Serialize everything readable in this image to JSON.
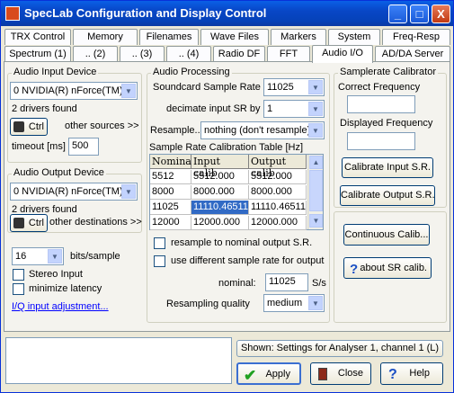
{
  "window": {
    "title": "SpecLab   Configuration and Display Control",
    "min": "_",
    "max": "□",
    "close": "X"
  },
  "tabs_row1": [
    "TRX Control",
    "Memory",
    "Filenames",
    "Wave Files",
    "Markers",
    "System",
    "Freq-Resp"
  ],
  "tabs_row2": [
    "Spectrum (1)",
    ".. (2)",
    ".. (3)",
    ".. (4)",
    "Radio DF",
    "FFT",
    "Audio I/O",
    "AD/DA Server"
  ],
  "audio_input": {
    "group": "Audio Input Device",
    "device": "0 NVIDIA(R) nForce(TM) Au",
    "drivers": "2 drivers found",
    "ctrl": "Ctrl",
    "other": "other sources >>",
    "timeout_label": "timeout [ms]",
    "timeout": "500"
  },
  "audio_output": {
    "group": "Audio Output Device",
    "device": "0 NVIDIA(R) nForce(TM) Au",
    "drivers": "2 drivers found",
    "ctrl": "Ctrl",
    "other": "other destinations >>"
  },
  "bits": {
    "value": "16",
    "label": "bits/sample"
  },
  "stereo": "Stereo Input",
  "minlat": "minimize latency",
  "iq_link": "I/Q input adjustment...",
  "processing": {
    "group": "Audio Processing",
    "sr_label": "Soundcard Sample Rate",
    "sr": "11025",
    "dec_label": "decimate input SR by",
    "dec": "1",
    "res_label": "Resample..",
    "res": "nothing (don't resample)",
    "table_label": "Sample Rate Calibration Table [Hz]",
    "headers": [
      "Nominal",
      "Input calib",
      "Output calib"
    ],
    "rows": [
      [
        "5512",
        "5512.000",
        "5512.000"
      ],
      [
        "8000",
        "8000.000",
        "8000.000"
      ],
      [
        "11025",
        "11110.46511",
        "11110.46511"
      ],
      [
        "12000",
        "12000.000",
        "12000.000"
      ]
    ],
    "resamp_nominal": "resample to nominal output S.R.",
    "diff_sr": "use different sample rate for output",
    "nominal_label": "nominal:",
    "nominal": "11025",
    "nominal_unit": "S/s",
    "quality_label": "Resampling quality",
    "quality": "medium"
  },
  "calibrator": {
    "group": "Samplerate Calibrator",
    "correct": "Correct Frequency",
    "displayed": "Displayed Frequency",
    "cal_in": "Calibrate Input S.R.",
    "cal_out": "Calibrate Output S.R.",
    "continuous": "Continuous Calib...",
    "about": "about SR calib."
  },
  "footer": {
    "shown": "Shown: Settings for Analyser 1, channel 1 (L)",
    "apply": "Apply",
    "close": "Close",
    "help": "Help"
  }
}
